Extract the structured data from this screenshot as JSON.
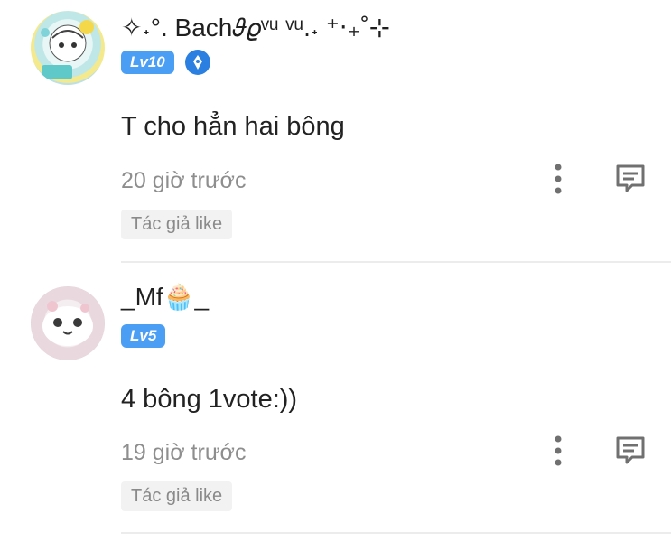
{
  "comments": [
    {
      "username": "✧˖°. Bach𝜗𝜚ᵛᵘ ᵛᵘ.˖ ⁺‧₊˚⊹",
      "level": "Lv10",
      "content": "T cho hẳn hai bông",
      "time": "20 giờ trước",
      "tag": "Tác giả like"
    },
    {
      "username": "_Mf🧁_",
      "level": "Lv5",
      "content": "4 bông 1vote:))",
      "time": "19 giờ trước",
      "tag": "Tác giả like"
    }
  ],
  "colors": {
    "level_badge": "#4a9ff5",
    "icon": "#707070",
    "muted_text": "#8e8e8e"
  }
}
